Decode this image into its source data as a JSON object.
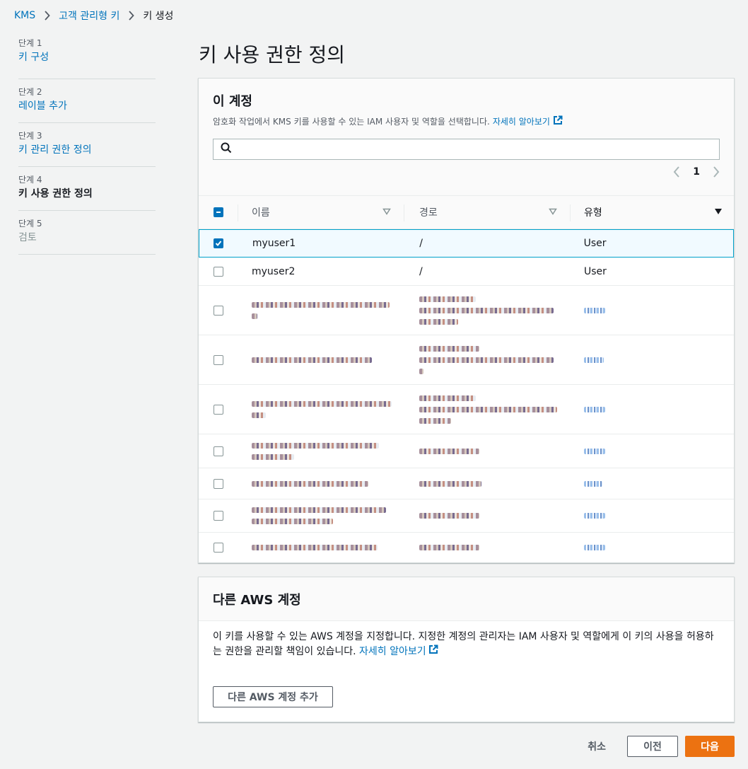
{
  "breadcrumb": {
    "items": [
      "KMS",
      "고객 관리형 키",
      "키 생성"
    ]
  },
  "steps": [
    {
      "num": "단계 1",
      "label": "키 구성",
      "state": "link"
    },
    {
      "num": "단계 2",
      "label": "레이블 추가",
      "state": "link"
    },
    {
      "num": "단계 3",
      "label": "키 관리 권한 정의",
      "state": "link"
    },
    {
      "num": "단계 4",
      "label": "키 사용 권한 정의",
      "state": "current"
    },
    {
      "num": "단계 5",
      "label": "검토",
      "state": "disabled"
    }
  ],
  "page_title": "키 사용 권한 정의",
  "this_account": {
    "title": "이 계정",
    "description": "암호화 작업에서 KMS 키를 사용할 수 있는 IAM 사용자 및 역할을 선택합니다.",
    "learn_more": "자세히 알아보기",
    "search_value": "",
    "pagination": {
      "current_page": "1"
    },
    "columns": {
      "name": "이름",
      "path": "경로",
      "type": "유형"
    },
    "rows": [
      {
        "name": "myuser1",
        "path": "/",
        "type": "User",
        "checked": true,
        "obscured": false
      },
      {
        "name": "myuser2",
        "path": "/",
        "type": "User",
        "checked": false,
        "obscured": false
      }
    ],
    "obscured_row_count": 8
  },
  "other_accounts": {
    "title": "다른 AWS 계정",
    "description": "이 키를 사용할 수 있는 AWS 계정을 지정합니다. 지정한 계정의 관리자는 IAM 사용자 및 역할에게 이 키의 사용을 허용하는 권한을 관리할 책임이 있습니다.",
    "learn_more": "자세히 알아보기",
    "add_button": "다른 AWS 계정 추가"
  },
  "footer": {
    "cancel": "취소",
    "previous": "이전",
    "next": "다음"
  },
  "colors": {
    "link": "#0073bb",
    "primary_button": "#ec7211",
    "selected_row": "#f1faff",
    "selected_border": "#00a1c9"
  }
}
